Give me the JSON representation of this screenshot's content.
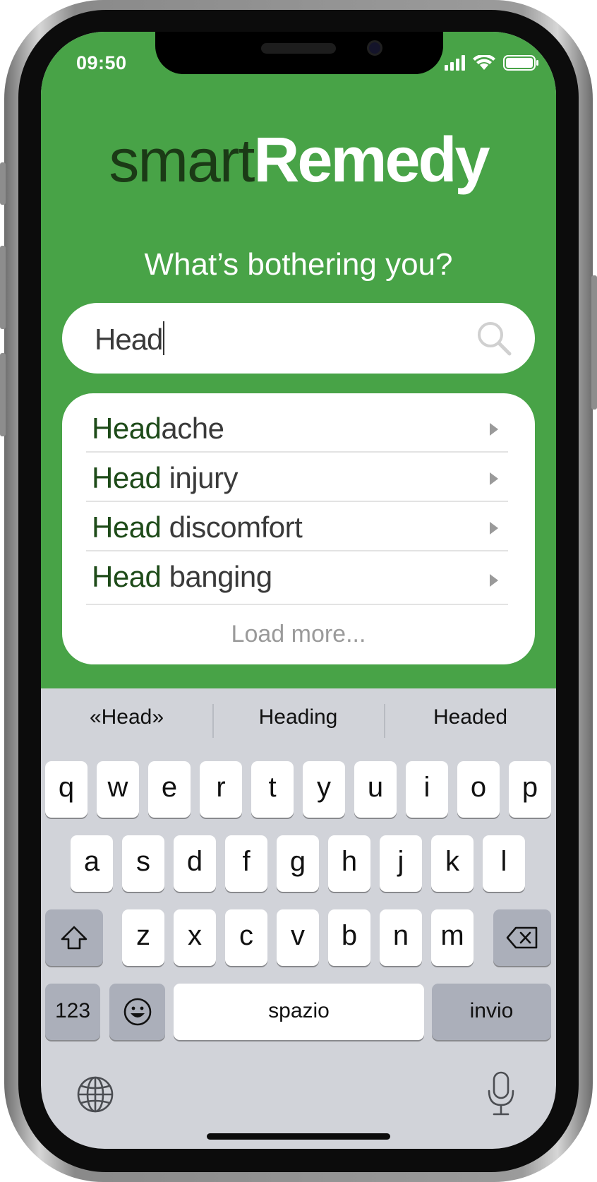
{
  "status_bar": {
    "time": "09:50",
    "icons": [
      "signal-icon",
      "wifi-icon",
      "battery-icon"
    ]
  },
  "app": {
    "logo_light": "smart",
    "logo_bold": "Remedy",
    "question": "What’s bothering you?",
    "colors": {
      "background": "#48a347",
      "logo_dark": "#1b3a16",
      "highlight": "#1e4b19"
    }
  },
  "search": {
    "value": "Head",
    "icon": "search-icon"
  },
  "suggestions": {
    "items": [
      {
        "match": "Head",
        "rest": "ache"
      },
      {
        "match": "Head",
        "rest": " injury"
      },
      {
        "match": "Head",
        "rest": " discomfort"
      },
      {
        "match": "Head",
        "rest": " banging"
      }
    ],
    "load_more": "Load more..."
  },
  "keyboard": {
    "predictions": [
      "«Head»",
      "Heading",
      "Headed"
    ],
    "row1": [
      "q",
      "w",
      "e",
      "r",
      "t",
      "y",
      "u",
      "i",
      "o",
      "p"
    ],
    "row2": [
      "a",
      "s",
      "d",
      "f",
      "g",
      "h",
      "j",
      "k",
      "l"
    ],
    "row3": [
      "z",
      "x",
      "c",
      "v",
      "b",
      "n",
      "m"
    ],
    "numbers_label": "123",
    "space_label": "spazio",
    "return_label": "invio",
    "icons": [
      "shift-icon",
      "backspace-icon",
      "emoji-icon",
      "globe-icon",
      "microphone-icon"
    ]
  }
}
